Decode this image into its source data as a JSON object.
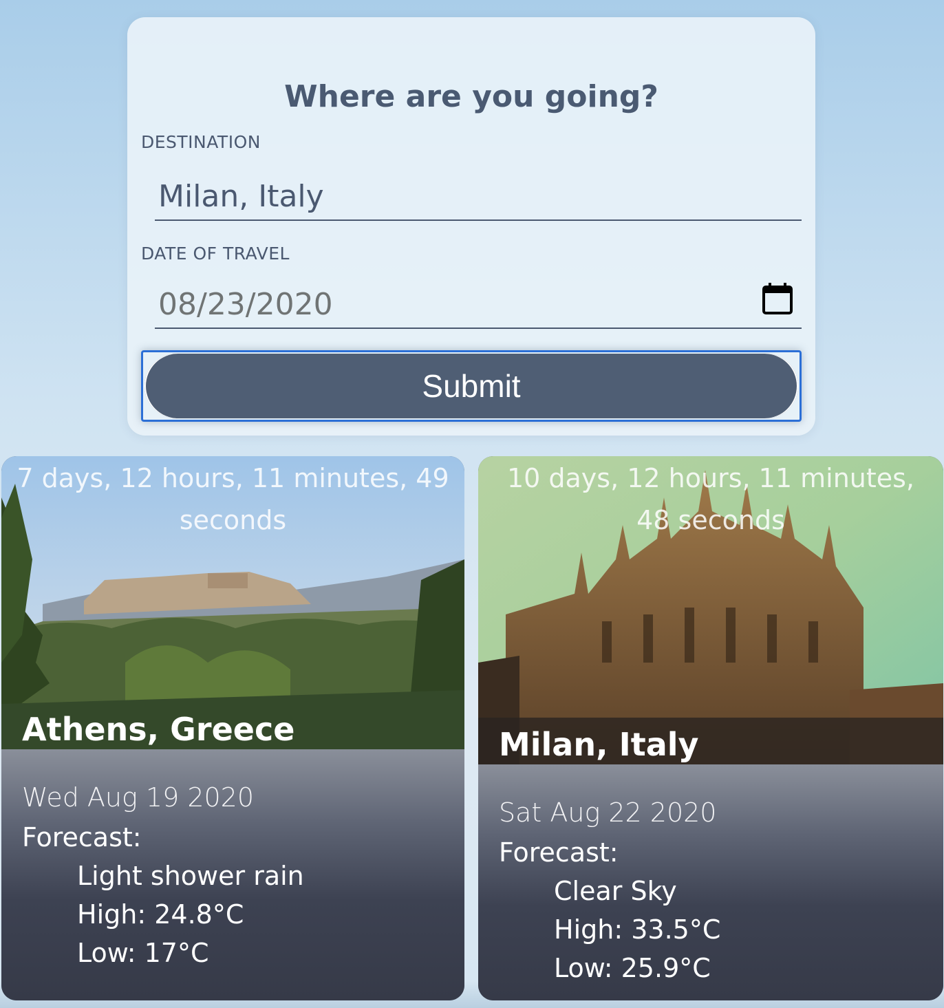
{
  "form": {
    "title": "Where are you going?",
    "destination_label": "DESTINATION",
    "destination_value": "Milan, Italy",
    "date_label": "DATE OF TRAVEL",
    "date_value": "08/23/2020",
    "submit_label": "Submit"
  },
  "trips": [
    {
      "countdown": "7 days, 12 hours, 11 minutes, 49 seconds",
      "city": "Athens, Greece",
      "date": "Wed Aug 19 2020",
      "forecast_label": "Forecast:",
      "description": "Light shower rain",
      "high": "High: 24.8°C",
      "low": "Low: 17°C"
    },
    {
      "countdown": "10 days, 12 hours, 11 minutes, 48 seconds",
      "city": "Milan, Italy",
      "date": "Sat Aug 22 2020",
      "forecast_label": "Forecast:",
      "description": "Clear Sky",
      "high": "High: 33.5°C",
      "low": "Low: 25.9°C"
    }
  ],
  "colors": {
    "accent": "#4f5e74",
    "focus_ring": "#2b6fd6"
  }
}
